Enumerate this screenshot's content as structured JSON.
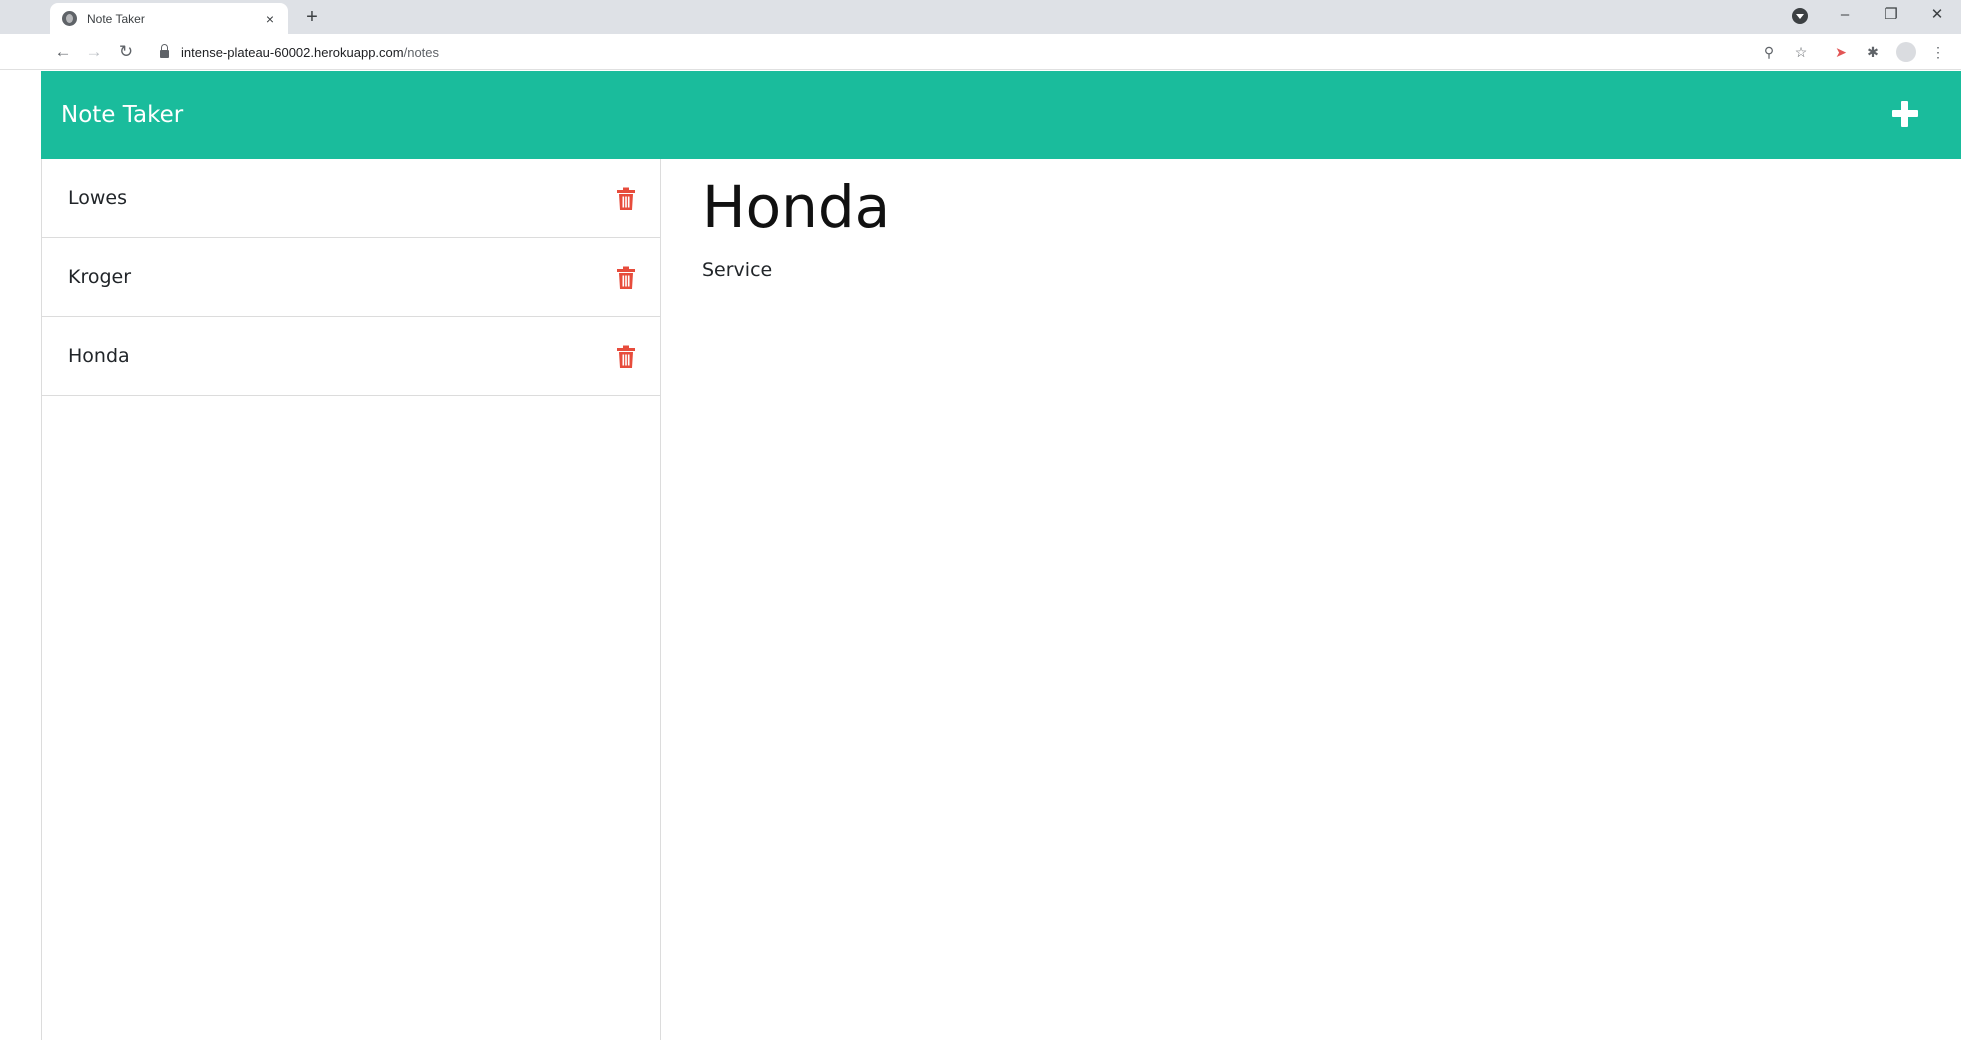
{
  "browser": {
    "tab_title": "Note Taker",
    "tab_close": "×",
    "new_tab": "+",
    "url_host": "intense-plateau-60002.herokuapp.com",
    "url_path": "/notes"
  },
  "app": {
    "brand": "Note Taker",
    "accent_color": "#1abc9c",
    "delete_color": "#e74c3c"
  },
  "notes": [
    {
      "title": "Lowes"
    },
    {
      "title": "Kroger"
    },
    {
      "title": "Honda"
    }
  ],
  "active_note": {
    "title": "Honda",
    "text": "Service"
  }
}
